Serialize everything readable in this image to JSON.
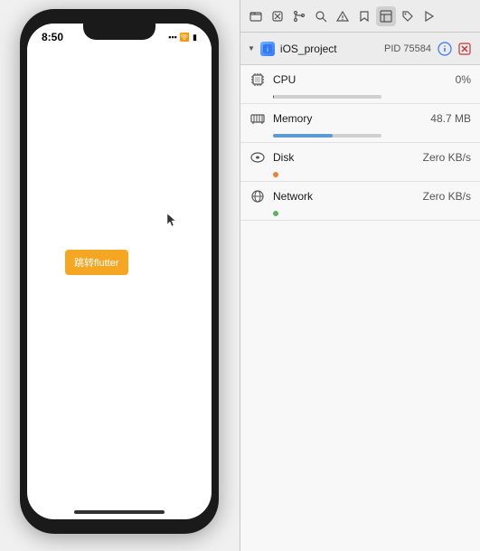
{
  "simulator": {
    "status_time": "8:50",
    "flutter_button_label": "跳转flutter"
  },
  "debug": {
    "toolbar": {
      "icons": [
        "folder",
        "stop",
        "branch",
        "search",
        "warning",
        "bookmark",
        "table",
        "tag",
        "play"
      ]
    },
    "process": {
      "name": "iOS_project",
      "pid_label": "PID 75584",
      "triangle": "▶"
    },
    "metrics": [
      {
        "name": "CPU",
        "value": "0%",
        "bar_type": "bar",
        "bar_class": "bar-cpu",
        "icon_type": "cpu"
      },
      {
        "name": "Memory",
        "value": "48.7 MB",
        "bar_type": "bar",
        "bar_class": "bar-memory",
        "icon_type": "memory"
      },
      {
        "name": "Disk",
        "value": "Zero KB/s",
        "bar_type": "dot",
        "dot_class": "dot-disk",
        "icon_type": "disk"
      },
      {
        "name": "Network",
        "value": "Zero KB/s",
        "bar_type": "dot",
        "dot_class": "dot-network",
        "icon_type": "network"
      }
    ]
  }
}
